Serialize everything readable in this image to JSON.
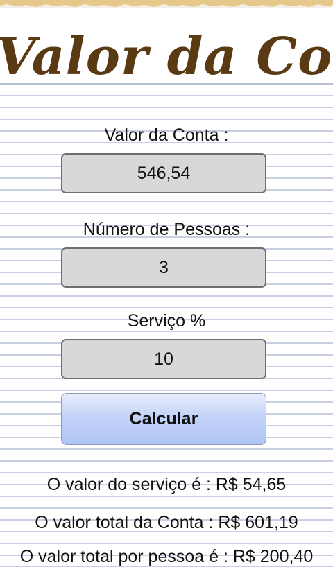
{
  "app": {
    "title": "Valor da Conta"
  },
  "form": {
    "bill_label": "Valor da Conta :",
    "bill_value": "546,54",
    "people_label": "Número de Pessoas :",
    "people_value": "3",
    "service_label": "Serviço %",
    "service_value": "10",
    "calculate_label": "Calcular"
  },
  "results": {
    "service_line": "O valor do serviço é : R$ 54,65",
    "total_line": "O valor total da Conta : R$ 601,19",
    "per_person_line": "O valor total por pessoa é : R$ 200,40"
  },
  "colors": {
    "title": "#5a3a12",
    "paper_lines": "#c9cfe3",
    "input_background": "#d8d8d8",
    "button_gradient_top": "#e8eefd",
    "button_gradient_bottom": "#afc4f3"
  }
}
